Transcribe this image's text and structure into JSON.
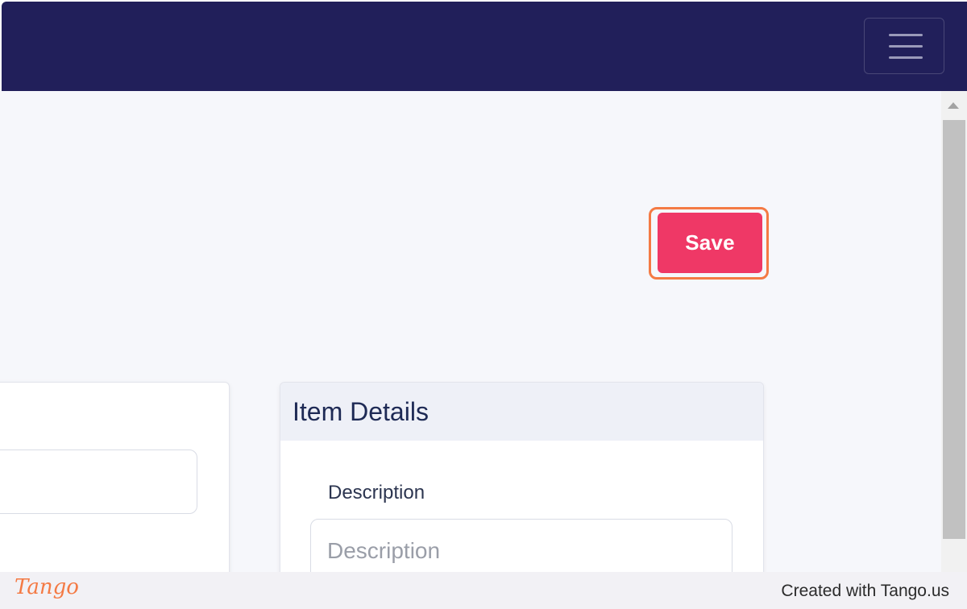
{
  "navbar": {
    "background_color": "#211f5a",
    "menu_toggle_icon": "hamburger-menu-icon"
  },
  "toolbar": {
    "save_label": "Save",
    "save_color": "#ef3866",
    "highlight_color": "#f47a44"
  },
  "item_details": {
    "title": "Item Details",
    "description_label": "Description",
    "description_placeholder": "Description",
    "description_value": ""
  },
  "footer": {
    "logo_text": "Tango",
    "credit": "Created with Tango.us"
  }
}
